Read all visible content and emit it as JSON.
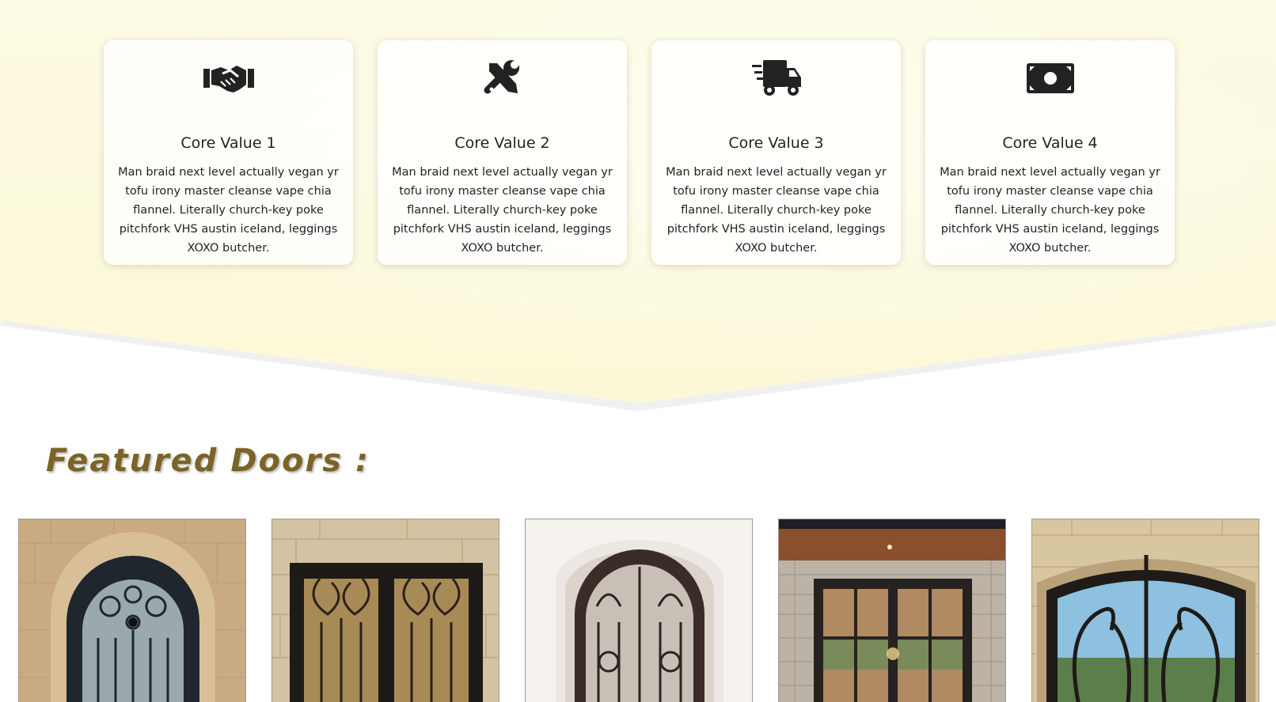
{
  "core_values": [
    {
      "icon": "handshake-icon",
      "title": "Core Value 1",
      "text": "Man braid next level actually vegan yr tofu irony master cleanse vape chia flannel. Literally church-key poke pitchfork VHS austin iceland, leggings XOXO butcher."
    },
    {
      "icon": "tools-icon",
      "title": "Core Value 2",
      "text": "Man braid next level actually vegan yr tofu irony master cleanse vape chia flannel. Literally church-key poke pitchfork VHS austin iceland, leggings XOXO butcher."
    },
    {
      "icon": "delivery-truck-icon",
      "title": "Core Value 3",
      "text": "Man braid next level actually vegan yr tofu irony master cleanse vape chia flannel. Literally church-key poke pitchfork VHS austin iceland, leggings XOXO butcher."
    },
    {
      "icon": "money-bill-icon",
      "title": "Core Value 4",
      "text": "Man braid next level actually vegan yr tofu irony master cleanse vape chia flannel. Literally church-key poke pitchfork VHS austin iceland, leggings XOXO butcher."
    }
  ],
  "featured": {
    "title": "Featured Doors :"
  },
  "colors": {
    "band": "#fcf8d6",
    "title": "#7a6426",
    "icon": "#222222"
  }
}
